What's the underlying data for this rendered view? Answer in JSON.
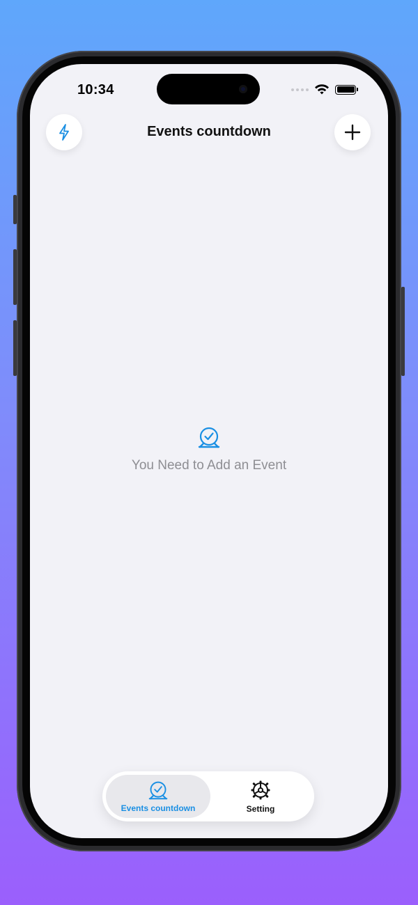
{
  "status_bar": {
    "time": "10:34"
  },
  "header": {
    "title": "Events countdown",
    "left_button_icon": "bolt-icon",
    "right_button_icon": "plus-icon"
  },
  "empty_state": {
    "icon": "alarm-clock-icon",
    "message": "You Need to Add an Event"
  },
  "tab_bar": {
    "tabs": [
      {
        "label": "Events countdown",
        "icon": "alarm-clock-icon",
        "selected": true
      },
      {
        "label": "Setting",
        "icon": "gear-icon",
        "selected": false
      }
    ]
  },
  "colors": {
    "accent": "#1a8fe3",
    "background_top": "#5fa7fb",
    "background_bottom": "#9b5ffc",
    "screen": "#f2f2f7",
    "secondary_text": "#8e8e93"
  }
}
